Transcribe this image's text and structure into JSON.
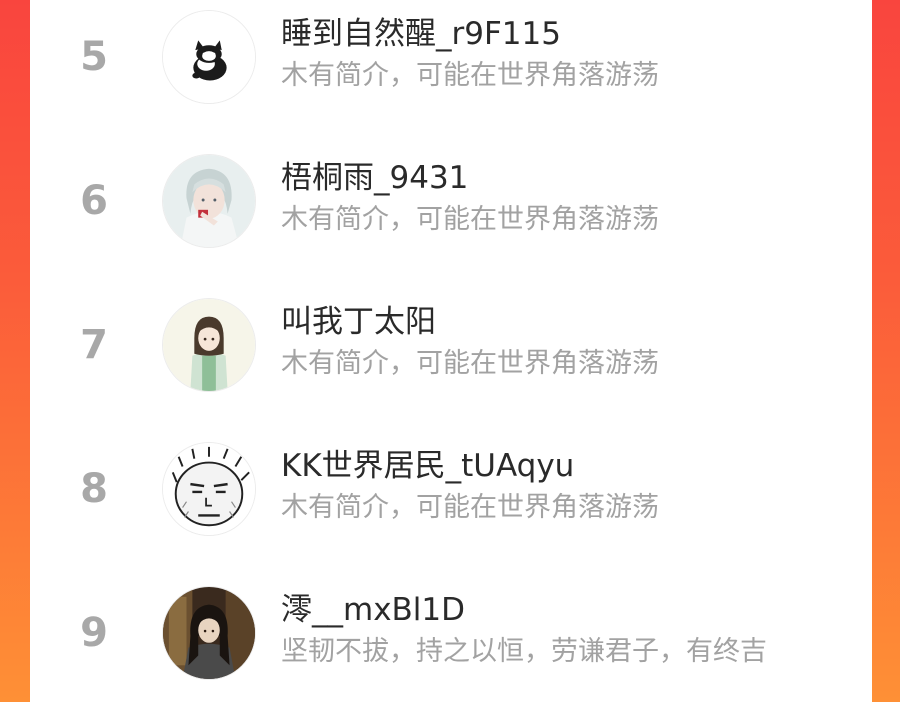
{
  "users": [
    {
      "rank": "5",
      "name": "睡到自然醒_r9F115",
      "bio": "木有简介，可能在世界角落游荡",
      "avatar_icon": "cat-avatar"
    },
    {
      "rank": "6",
      "name": "梧桐雨_9431",
      "bio": "木有简介，可能在世界角落游荡",
      "avatar_icon": "anime-boy-avatar"
    },
    {
      "rank": "7",
      "name": "叫我丁太阳",
      "bio": "木有简介，可能在世界角落游荡",
      "avatar_icon": "anime-girl-avatar"
    },
    {
      "rank": "8",
      "name": "KK世界居民_tUAqyu",
      "bio": "木有简介，可能在世界角落游荡",
      "avatar_icon": "sketch-face-avatar"
    },
    {
      "rank": "9",
      "name": "澪__mxBl1D",
      "bio": "坚韧不拔，持之以恒，劳谦君子，有终吉",
      "avatar_icon": "dark-hair-girl-avatar"
    }
  ],
  "colors": {
    "rank": "#a8a8a8",
    "name": "#2a2a2a",
    "bio": "#a2a2a2",
    "background_top": "#f9453e",
    "background_bottom": "#fe9036"
  }
}
